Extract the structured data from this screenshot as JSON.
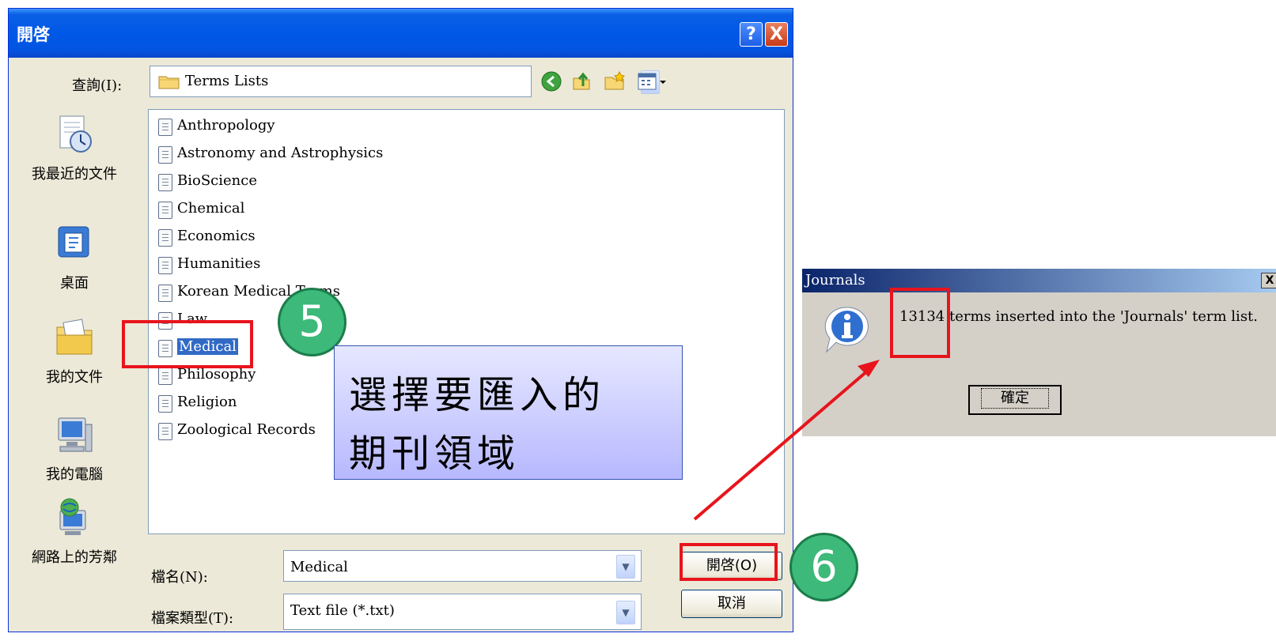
{
  "open_dialog": {
    "title": "開啓",
    "help_label": "?",
    "close_label": "X",
    "look_in_label": "查詢(I):",
    "look_in_value": "Terms Lists",
    "places": [
      {
        "label": "我最近的文件",
        "icon": "recent-documents-icon"
      },
      {
        "label": "桌面",
        "icon": "desktop-icon"
      },
      {
        "label": "我的文件",
        "icon": "my-documents-icon"
      },
      {
        "label": "我的電腦",
        "icon": "my-computer-icon"
      },
      {
        "label": "網路上的芳鄰",
        "icon": "network-places-icon"
      }
    ],
    "files": [
      "Anthropology",
      "Astronomy and Astrophysics",
      "BioScience",
      "Chemical",
      "Economics",
      "Humanities",
      "Korean Medical Terms",
      "Law",
      "Medical",
      "Philosophy",
      "Religion",
      "Zoological Records"
    ],
    "selected_file": "Medical",
    "file_name_label": "檔名(N):",
    "file_name_value": "Medical",
    "file_type_label": "檔案類型(T):",
    "file_type_value": "Text file  (*.txt)",
    "open_button": "開啓(O)",
    "cancel_button": "取消"
  },
  "journals_dialog": {
    "title": "Journals",
    "close_label": "X",
    "count": "13134",
    "message": "terms inserted into the 'Journals' term list.",
    "ok_button": "確定"
  },
  "annotations": {
    "step5": "5",
    "step6": "6",
    "note_line1": "選擇要匯入的",
    "note_line2": "期刊領域",
    "highlight_color": "#e8141c",
    "badge_color": "#3db97a"
  }
}
